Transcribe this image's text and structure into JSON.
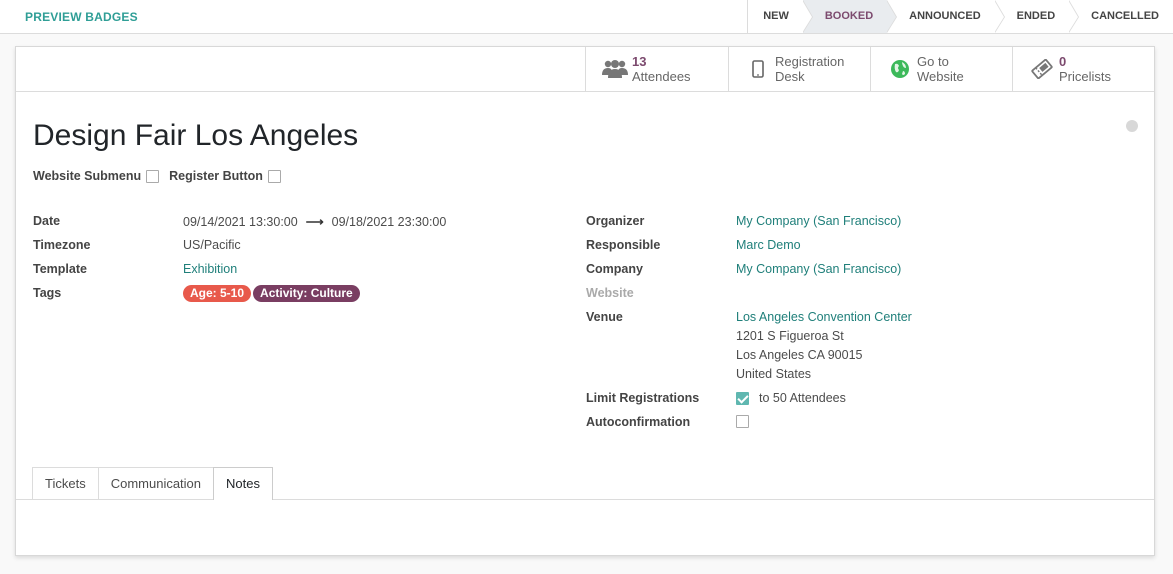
{
  "toolbar": {
    "preview_badges": "PREVIEW BADGES"
  },
  "stages": [
    {
      "label": "NEW"
    },
    {
      "label": "BOOKED"
    },
    {
      "label": "ANNOUNCED"
    },
    {
      "label": "ENDED"
    },
    {
      "label": "CANCELLED"
    }
  ],
  "smart_buttons": {
    "attendees": {
      "count": "13",
      "label": "Attendees"
    },
    "registration_desk": {
      "line1": "Registration",
      "line2": "Desk"
    },
    "website": {
      "line1": "Go to",
      "line2": "Website"
    },
    "pricelists": {
      "count": "0",
      "label": "Pricelists"
    }
  },
  "event": {
    "name": "Design Fair Los Angeles",
    "website_submenu_label": "Website Submenu",
    "register_button_label": "Register Button"
  },
  "left_fields": {
    "date": {
      "label": "Date",
      "start": "09/14/2021 13:30:00",
      "end": "09/18/2021 23:30:00",
      "arrow": "⟶"
    },
    "timezone": {
      "label": "Timezone",
      "value": "US/Pacific"
    },
    "template": {
      "label": "Template",
      "value": "Exhibition"
    },
    "tags": {
      "label": "Tags",
      "items": [
        {
          "name": "Age: 5-10",
          "color": "#e8594b"
        },
        {
          "name": "Activity: Culture",
          "color": "#7a3e62"
        }
      ]
    }
  },
  "right_fields": {
    "organizer": {
      "label": "Organizer",
      "value": "My Company (San Francisco)"
    },
    "responsible": {
      "label": "Responsible",
      "value": "Marc Demo"
    },
    "company": {
      "label": "Company",
      "value": "My Company (San Francisco)"
    },
    "website": {
      "label": "Website",
      "value": ""
    },
    "venue": {
      "label": "Venue",
      "name": "Los Angeles Convention Center",
      "street": "1201 S Figueroa St",
      "city": "Los Angeles CA 90015",
      "country": "United States"
    },
    "limit_registrations": {
      "label": "Limit Registrations",
      "value": "to 50 Attendees"
    },
    "autoconfirmation": {
      "label": "Autoconfirmation"
    }
  },
  "tabs": [
    {
      "label": "Tickets"
    },
    {
      "label": "Communication"
    },
    {
      "label": "Notes"
    }
  ],
  "colors": {
    "accent": "#2f9e96",
    "brand": "#7c4a6e",
    "link": "#1f7f7a"
  }
}
